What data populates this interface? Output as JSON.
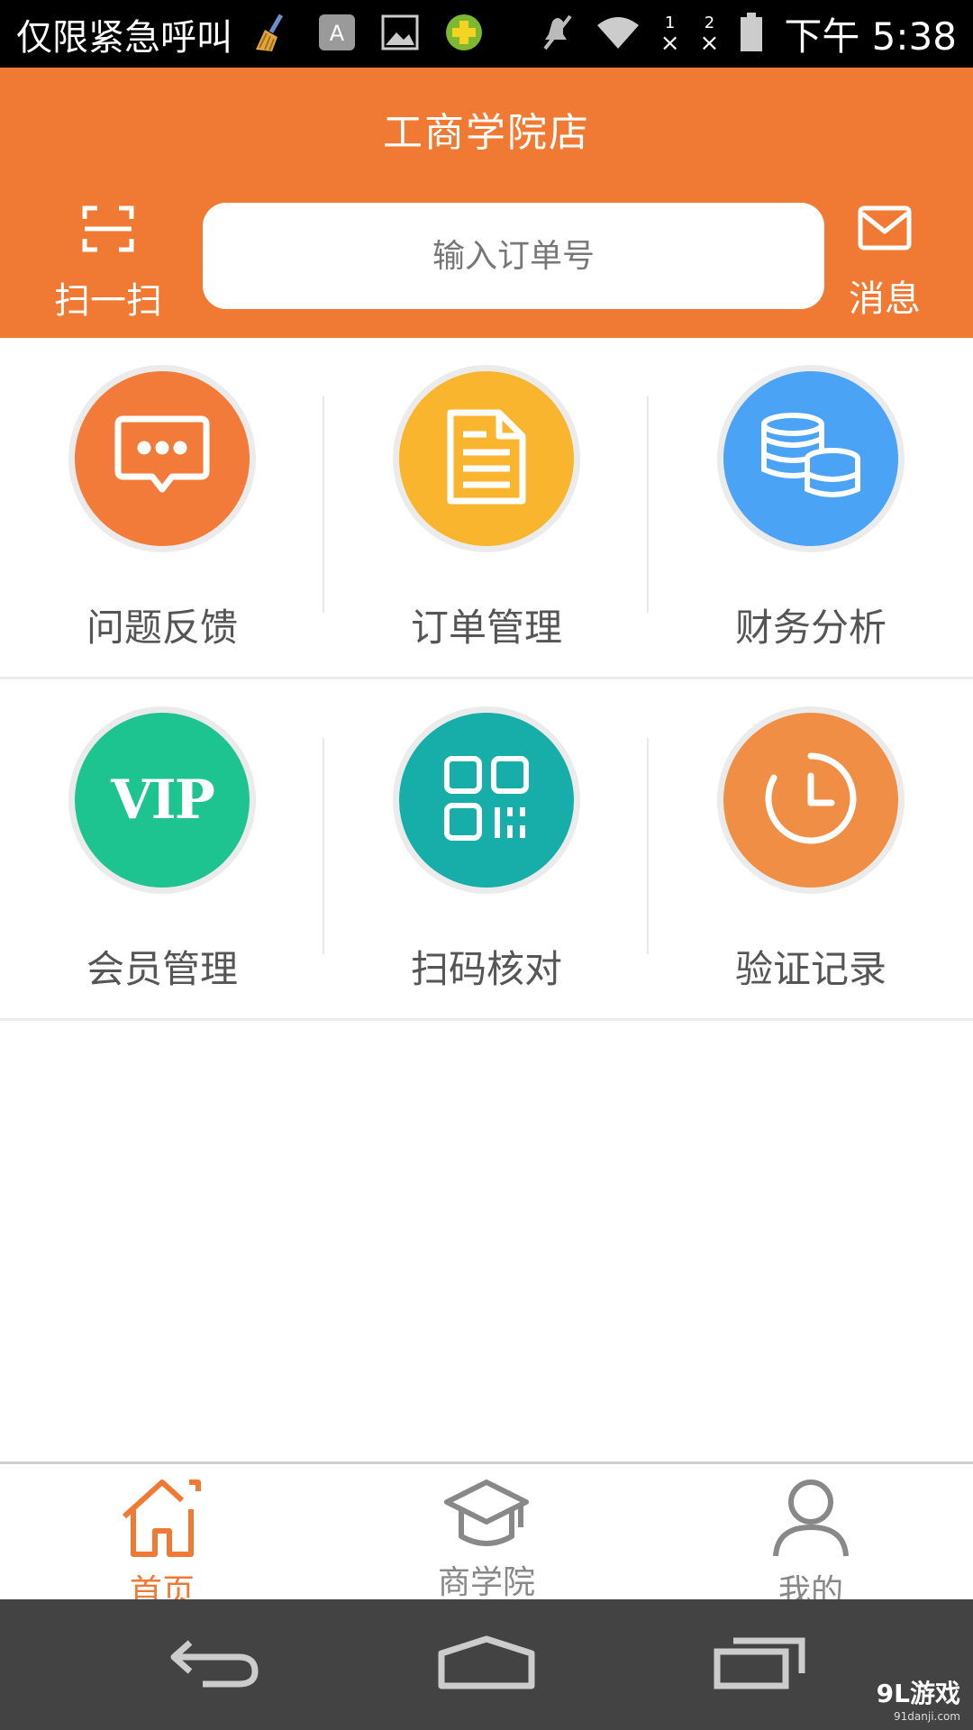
{
  "status_bar": {
    "carrier": "仅限紧急呼叫",
    "sim1": "1",
    "sim2": "2",
    "sim_x": "×",
    "time": "下午 5:38"
  },
  "header": {
    "store_name": "工商学院店",
    "scan_label": "扫一扫",
    "search_placeholder": "输入订单号",
    "message_label": "消息"
  },
  "grid": {
    "items": [
      {
        "label": "问题反馈",
        "color": "#f27b3a",
        "icon": "chat-bubble-icon"
      },
      {
        "label": "订单管理",
        "color": "#f8b52d",
        "icon": "document-icon"
      },
      {
        "label": "财务分析",
        "color": "#4aa3f5",
        "icon": "coins-icon"
      },
      {
        "label": "会员管理",
        "color": "#1ec48f",
        "icon": "vip-icon",
        "badge": "VIP"
      },
      {
        "label": "扫码核对",
        "color": "#17ada8",
        "icon": "qr-code-icon"
      },
      {
        "label": "验证记录",
        "color": "#f08e45",
        "icon": "clock-icon"
      }
    ]
  },
  "tabbar": {
    "tabs": [
      {
        "label": "首页",
        "active": true
      },
      {
        "label": "商学院",
        "active": false
      },
      {
        "label": "我的",
        "active": false
      }
    ]
  },
  "watermark": {
    "brand": "9L游戏",
    "url": "91danji.com"
  },
  "colors": {
    "accent": "#f07a33",
    "tab_inactive": "#888888"
  }
}
